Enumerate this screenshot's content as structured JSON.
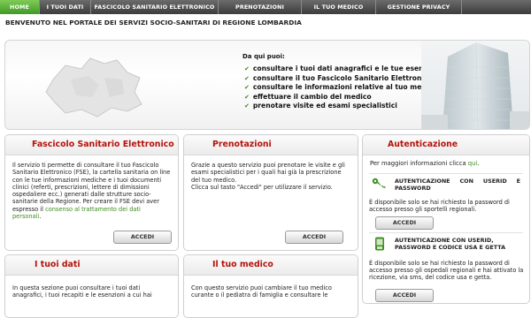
{
  "nav": {
    "tabs": [
      "HOME",
      "I TUOI DATI",
      "FASCICOLO SANITARIO ELETTRONICO",
      "PRENOTAZIONI",
      "IL TUO MEDICO",
      "GESTIONE PRIVACY"
    ],
    "active": "HOME",
    "active_color": "#52ad34"
  },
  "welcome": "BENVENUTO NEL PORTALE DEI SERVIZI SOCIO-SANITARI DI REGIONE LOMBARDIA",
  "hero": {
    "intro": "Da qui puoi:",
    "bullets": [
      "consultare i tuoi dati anagrafici e le tue esenzioni",
      "consultare il tuo Fascicolo Sanitario Elettronico (FSE)",
      "consultare le informazioni relative al tuo medico",
      "effettuare il cambio del medico",
      "prenotare visite ed esami specialistici"
    ]
  },
  "fse": {
    "title": "Fascicolo Sanitario Elettronico",
    "text": "Il servizio ti permette di consultare il tuo Fascicolo Sanitario Elettronico (FSE), la cartella sanitaria on line con le tue informazioni mediche e i tuoi documenti clinici (referti, prescrizioni, lettere di dimissioni ospedaliere ecc.) generati dalle strutture socio-sanitarie della Regione. Per creare il FSE devi aver espresso il ",
    "link": "consenso al trattamento dei dati personali",
    "text_end": ".",
    "button": "ACCEDI"
  },
  "prenotazioni": {
    "title": "Prenotazioni",
    "text": "Grazie a questo servizio puoi prenotare le visite e gli esami specialistici per i quali hai già la prescrizione del tuo medico.",
    "text2": "Clicca sul tasto \"Accedi\" per utilizzare il servizio.",
    "button": "ACCEDI"
  },
  "autenticazione": {
    "title": "Autenticazione",
    "info_prefix": "Per maggiori informazioni clicca ",
    "info_link": "qui",
    "info_suffix": ".",
    "option1": {
      "title": "AUTENTICAZIONE CON USERID E PASSWORD",
      "text": "È disponibile solo se hai richiesto la password di accesso presso gli sportelli regionali.",
      "button": "ACCEDI"
    },
    "option2": {
      "title": "AUTENTICAZIONE CON USERID, PASSWORD E CODICE USA E GETTA",
      "text": "È disponibile solo se hai richiesto la password di accesso presso gli ospedali regionali e hai attivato la ricezione, via sms, del codice usa e getta.",
      "button": "ACCEDI"
    }
  },
  "tuoi_dati": {
    "title": "I tuoi dati",
    "text": "In questa sezione puoi consultare i tuoi dati anagrafici, i tuoi recapiti e le esenzioni a cui hai"
  },
  "tuo_medico": {
    "title": "Il tuo medico",
    "text": "Con questo servizio puoi cambiare il tuo medico curante o il pediatra di famiglia e consultare le"
  }
}
